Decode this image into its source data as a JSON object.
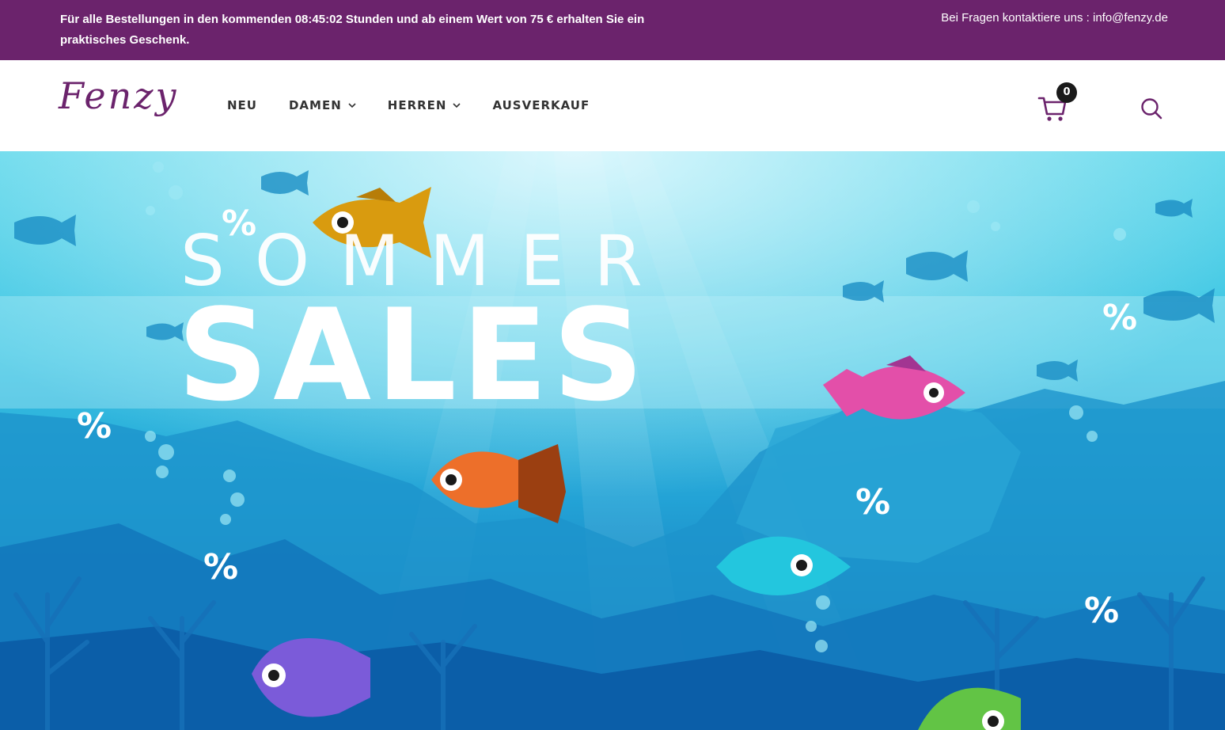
{
  "topbar": {
    "promo": "Für alle Bestellungen in den kommenden  08:45:02 Stunden und ab einem Wert von 75 € erhalten Sie ein praktisches Geschenk.",
    "contact": "Bei Fragen kontaktiere uns : info@fenzy.de"
  },
  "header": {
    "logo": "Fenzy",
    "nav": [
      {
        "label": "NEU",
        "has_dropdown": false
      },
      {
        "label": "DAMEN",
        "has_dropdown": true
      },
      {
        "label": "HERREN",
        "has_dropdown": true
      },
      {
        "label": "AUSVERKAUF",
        "has_dropdown": false
      }
    ],
    "cart_count": "0",
    "cart_icon": "cart-icon",
    "search_icon": "search-icon"
  },
  "hero": {
    "title_line1": "SOMMER",
    "title_line2": "SALES",
    "percent_symbol": "%"
  },
  "colors": {
    "brand": "#6b236c",
    "hero_sky": "#4fd0e6",
    "hero_deep": "#0c5fae"
  }
}
